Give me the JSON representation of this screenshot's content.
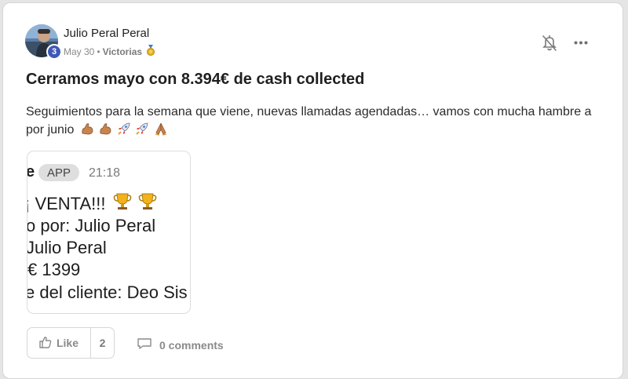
{
  "post": {
    "author": {
      "name": "Julio Peral Peral",
      "level": "3",
      "avatar_icon": "user-photo-icon"
    },
    "date": "May 30",
    "separator": "•",
    "category": "Victorias",
    "category_icon": "medal-icon",
    "title": "Cerramos mayo con 8.394€ de cash collected",
    "body": "Seguimientos para la semana que viene, nuevas llamadas agendadas… vamos con mucha hambre a por junio",
    "body_emojis": [
      "flexed-biceps-icon",
      "flexed-biceps-icon",
      "rocket-icon",
      "rocket-icon",
      "praying-hands-icon"
    ],
    "header_icons": [
      "bell-off-icon",
      "more-options-icon"
    ],
    "attachment": {
      "edge_char": "e",
      "app_label": "APP",
      "time": "21:18",
      "lines": [
        "¡ VENTA!!!",
        "o por: Julio Peral",
        "Julio Peral",
        "€ 1399",
        "e del cliente:  Deo Sis"
      ],
      "trophy_icons": [
        "trophy-icon",
        "trophy-icon"
      ]
    },
    "actions": {
      "like_label": "Like",
      "like_count": "2",
      "comments_label": "0 comments"
    }
  },
  "colors": {
    "badge": "#3e59b8",
    "text": "#1f1f1f",
    "muted": "#8a8a8a",
    "border": "#d6d6d6"
  }
}
